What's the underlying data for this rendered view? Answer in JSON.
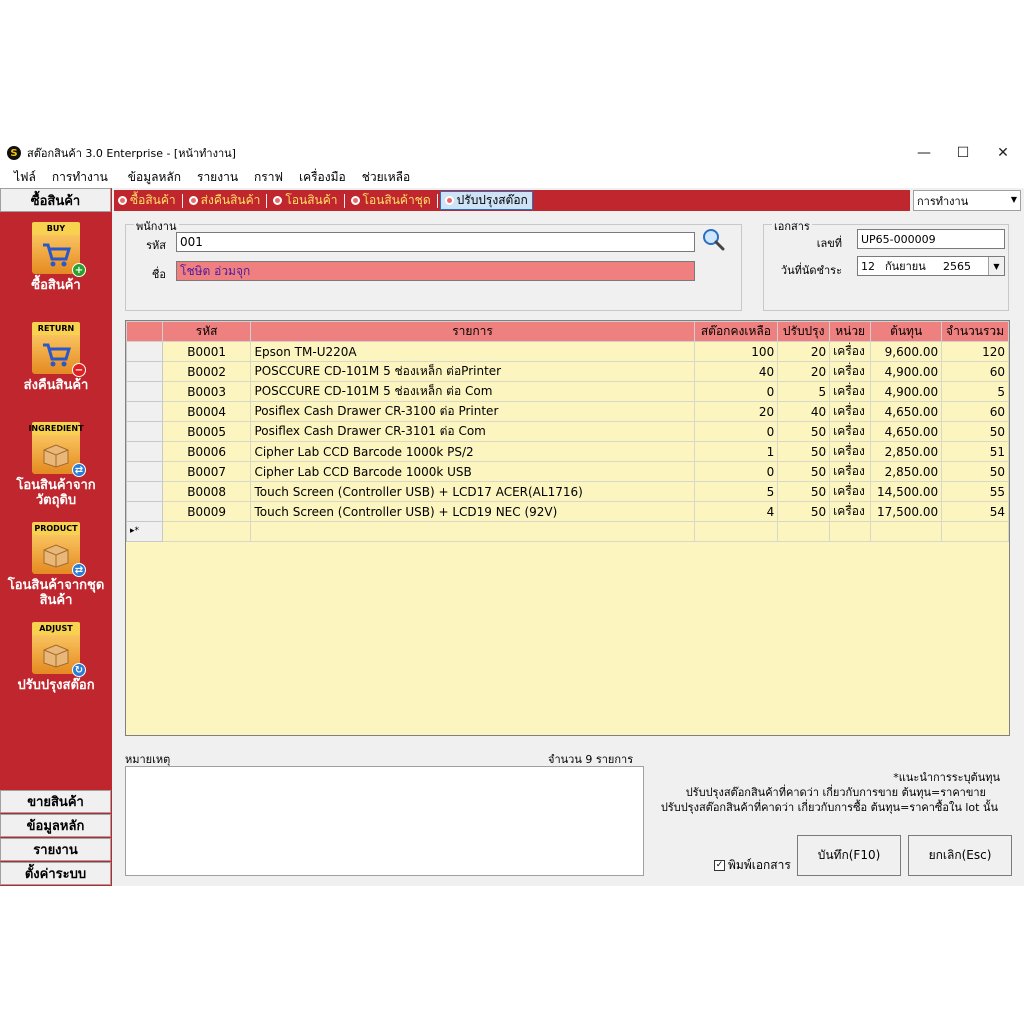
{
  "window": {
    "title": "สต๊อกสินค้า 3.0 Enterprise - [หน้าทำงาน]",
    "logo": "S",
    "controls": {
      "minimize": "—",
      "maximize": "☐",
      "close": "✕"
    }
  },
  "menu": [
    "ไฟล์",
    "การทำงาน",
    "ข้อมูลหลัก",
    "รายงาน",
    "กราฟ",
    "เครื่องมือ",
    "ช่วยเหลือ"
  ],
  "sidebar": {
    "header": "ซื้อสินค้า",
    "buttons": [
      {
        "tag": "BUY",
        "label": "ซื้อสินค้า",
        "icon": "cart-icon",
        "badge": "+",
        "badge_color": "#2ca02c"
      },
      {
        "tag": "RETURN",
        "label": "ส่งคืนสินค้า",
        "icon": "cart-icon",
        "badge": "−",
        "badge_color": "#e02020"
      },
      {
        "tag": "INGREDIENT",
        "label": "โอนสินค้าจาก วัตถุดิบ",
        "icon": "box-icon",
        "badge": "⇄",
        "badge_color": "#2b7cd3"
      },
      {
        "tag": "PRODUCT",
        "label": "โอนสินค้าจากชุด สินค้า",
        "icon": "box-icon",
        "badge": "⇄",
        "badge_color": "#2b7cd3"
      },
      {
        "tag": "ADJUST",
        "label": "ปรับปรุงสต๊อก",
        "icon": "box-icon",
        "badge": "↻",
        "badge_color": "#2b7cd3"
      }
    ],
    "bottom": [
      "ขายสินค้า",
      "ข้อมูลหลัก",
      "รายงาน",
      "ตั้งค่าระบบ"
    ]
  },
  "tabs": [
    {
      "label": "ซื้อสินค้า",
      "active": false
    },
    {
      "label": "ส่งคืนสินค้า",
      "active": false
    },
    {
      "label": "โอนสินค้า",
      "active": false
    },
    {
      "label": "โอนสินค้าชุด",
      "active": false
    },
    {
      "label": "ปรับปรุงสต๊อก",
      "active": true
    }
  ],
  "work_combo": "การทำงาน",
  "employee": {
    "group_title": "พนักงาน",
    "code_label": "รหัส",
    "code_value": "001",
    "name_label": "ชื่อ",
    "name_value": "โชษิต  อ่วมจุก"
  },
  "document": {
    "group_title": "เอกสาร",
    "number_label": "เลขที่",
    "number_value": "UP65-000009",
    "date_label": "วันที่นัดชำระ",
    "date_day": "12",
    "date_month": "กันยายน",
    "date_year": "2565"
  },
  "grid": {
    "columns": [
      "",
      "รหัส",
      "รายการ",
      "สต๊อกคงเหลือ",
      "ปรับปรุง",
      "หน่วย",
      "ต้นทุน",
      "จำนวนรวม"
    ],
    "rows": [
      [
        "B0001",
        "Epson TM-U220A",
        "100",
        "20",
        "เครื่อง",
        "9,600.00",
        "120"
      ],
      [
        "B0002",
        "POSCCURE CD-101M 5 ช่องเหล็ก ต่อPrinter",
        "40",
        "20",
        "เครื่อง",
        "4,900.00",
        "60"
      ],
      [
        "B0003",
        "POSCCURE CD-101M 5 ช่องเหล็ก ต่อ Com",
        "0",
        "5",
        "เครื่อง",
        "4,900.00",
        "5"
      ],
      [
        "B0004",
        "Posiflex Cash Drawer CR-3100 ต่อ Printer",
        "20",
        "40",
        "เครื่อง",
        "4,650.00",
        "60"
      ],
      [
        "B0005",
        "Posiflex Cash Drawer CR-3101 ต่อ Com",
        "0",
        "50",
        "เครื่อง",
        "4,650.00",
        "50"
      ],
      [
        "B0006",
        "Cipher Lab CCD Barcode 1000k PS/2",
        "1",
        "50",
        "เครื่อง",
        "2,850.00",
        "51"
      ],
      [
        "B0007",
        "Cipher Lab CCD Barcode 1000k USB",
        "0",
        "50",
        "เครื่อง",
        "2,850.00",
        "50"
      ],
      [
        "B0008",
        "Touch Screen (Controller USB) + LCD17 ACER(AL1716)",
        "5",
        "50",
        "เครื่อง",
        "14,500.00",
        "55"
      ],
      [
        "B0009",
        "Touch Screen (Controller USB) + LCD19 NEC (92V)",
        "4",
        "50",
        "เครื่อง",
        "17,500.00",
        "54"
      ]
    ],
    "new_row_marker": "▸*"
  },
  "footer": {
    "notes_label": "หมายเหตุ",
    "count_text": "จำนวน 9 รายการ",
    "hint_title": "*แนะนำการระบุต้นทุน",
    "hint_line1": "ปรับปรุงสต๊อกสินค้าที่คาดว่า  เกี่ยวกับการขาย  ต้นทุน=ราคาขาย",
    "hint_line2": "ปรับปรุงสต๊อกสินค้าที่คาดว่า  เกี่ยวกับการซื้อ  ต้นทุน=ราคาซื้อใน  lot นั้น",
    "print_label": "พิมพ์เอกสาร",
    "print_checked": true,
    "save_label": "บันทึก(F10)",
    "cancel_label": "ยกเลิก(Esc)"
  }
}
